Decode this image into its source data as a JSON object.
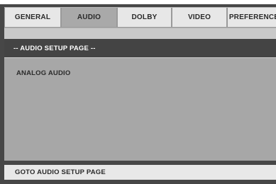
{
  "tabs": [
    {
      "label": "GENERAL",
      "selected": false
    },
    {
      "label": "AUDIO",
      "selected": true
    },
    {
      "label": "DOLBY",
      "selected": false
    },
    {
      "label": "VIDEO",
      "selected": false
    },
    {
      "label": "PREFERENCE",
      "selected": false
    }
  ],
  "page": {
    "header": "-- AUDIO SETUP PAGE --",
    "items": [
      "ANALOG AUDIO"
    ]
  },
  "status": {
    "text": "GOTO AUDIO SETUP PAGE"
  },
  "colors": {
    "frame": "#474747",
    "tab_bg": "#e7e7e7",
    "tab_selected": "#a9a9a9",
    "header_bg": "#444444",
    "content_bg": "#a7a7a7",
    "status_bg": "#e8e8e8"
  }
}
